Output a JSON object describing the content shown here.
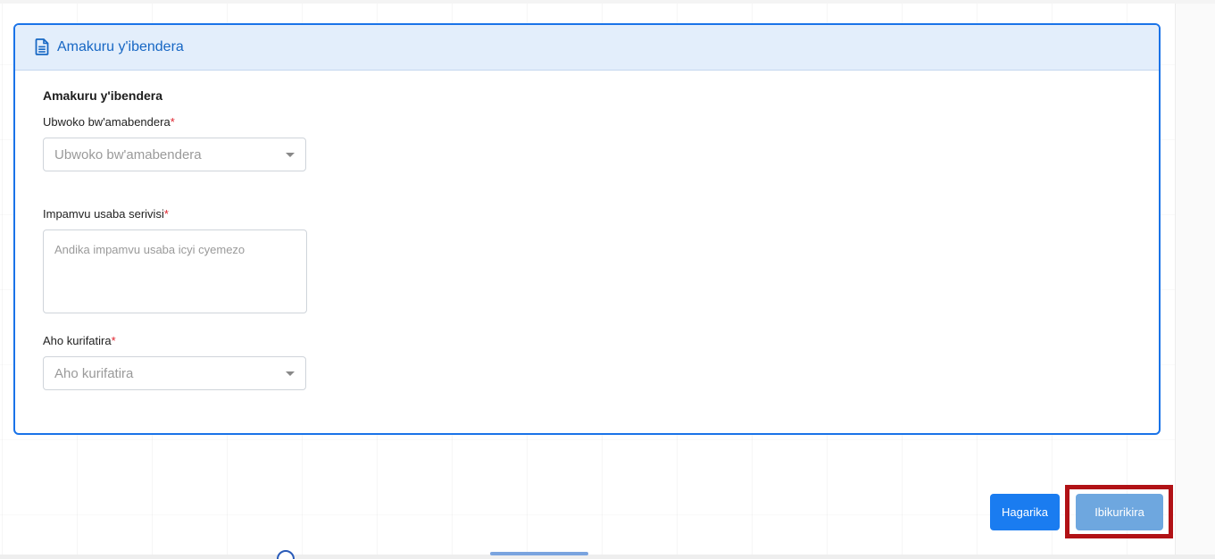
{
  "card": {
    "header_title": "Amakuru y'ibendera",
    "section_title": "Amakuru y'ibendera",
    "fields": [
      {
        "label": "Ubwoko bw'amabendera",
        "required_mark": "*",
        "type": "select",
        "placeholder": "Ubwoko bw'amabendera"
      },
      {
        "label": "Impamvu usaba serivisi",
        "required_mark": "*",
        "type": "textarea",
        "placeholder": "Andika impamvu usaba icyi cyemezo"
      },
      {
        "label": "Aho kurifatira",
        "required_mark": "*",
        "type": "select",
        "placeholder": "Aho kurifatira"
      }
    ]
  },
  "actions": {
    "cancel_label": "Hagarika",
    "submit_label": "Ibikurikira"
  },
  "colors": {
    "accent": "#1a73e8",
    "header_bg": "#e3eefb",
    "cancel_button": "#1a7cf0",
    "submit_button": "#6ea7df",
    "highlight": "#b11216",
    "required": "#e0242e"
  },
  "icons": {
    "header_icon": "document-icon",
    "select_caret": "caret-down-icon"
  }
}
